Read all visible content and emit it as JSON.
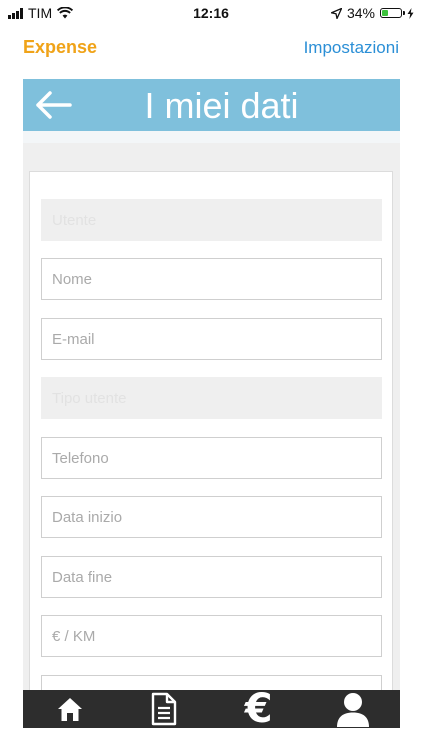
{
  "status_bar": {
    "carrier": "TIM",
    "time": "12:16",
    "battery_percent": "34%",
    "battery_level": 0.34,
    "icons": [
      "signal-icon",
      "wifi-icon",
      "location-icon",
      "battery-icon",
      "charging-icon"
    ]
  },
  "nav": {
    "left_label": "Expense",
    "right_label": "Impostazioni"
  },
  "header": {
    "title": "I miei dati",
    "back_icon": "arrow-left-icon"
  },
  "form": {
    "fields": [
      {
        "placeholder": "Utente",
        "value": "",
        "disabled": true
      },
      {
        "placeholder": "Nome",
        "value": "",
        "disabled": false
      },
      {
        "placeholder": "E-mail",
        "value": "",
        "disabled": false
      },
      {
        "placeholder": "Tipo utente",
        "value": "",
        "disabled": true
      },
      {
        "placeholder": "Telefono",
        "value": "",
        "disabled": false
      },
      {
        "placeholder": "Data inizio",
        "value": "",
        "disabled": false
      },
      {
        "placeholder": "Data fine",
        "value": "",
        "disabled": false
      },
      {
        "placeholder": "€ / KM",
        "value": "",
        "disabled": false
      },
      {
        "placeholder": "",
        "value": "",
        "disabled": false
      }
    ]
  },
  "tabbar": {
    "tabs": [
      {
        "icon": "home-icon"
      },
      {
        "icon": "document-icon"
      },
      {
        "icon": "euro-icon",
        "glyph": "€"
      },
      {
        "icon": "user-icon"
      }
    ]
  },
  "colors": {
    "accent_orange": "#f0a318",
    "link_blue": "#2b8fd6",
    "header_blue": "#7fc0dc",
    "tabbar_bg": "#2d2d2d",
    "battery_green": "#3cc23c"
  }
}
